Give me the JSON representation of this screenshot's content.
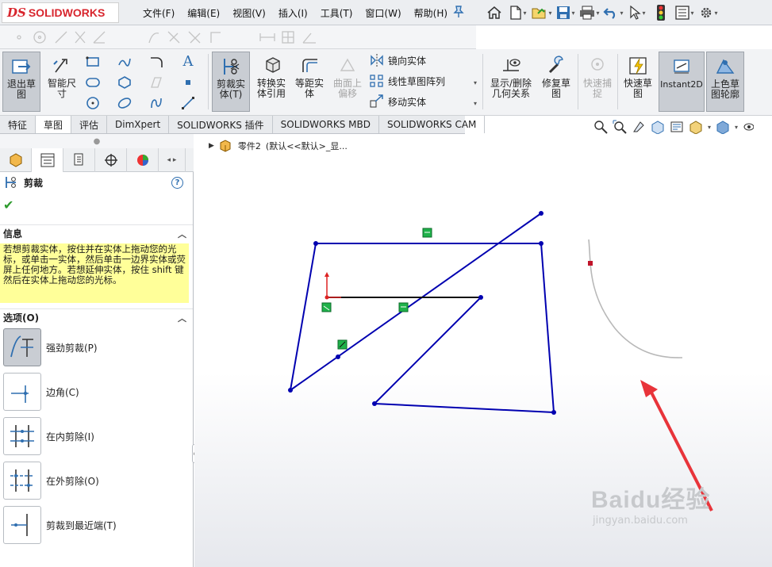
{
  "app": {
    "logo_prefix": "DS",
    "logo_text": "SOLIDWORKS"
  },
  "menu": {
    "items": [
      "文件(F)",
      "编辑(E)",
      "视图(V)",
      "插入(I)",
      "工具(T)",
      "窗口(W)",
      "帮助(H)"
    ]
  },
  "quick_access": [
    "home-icon",
    "new-document-icon",
    "open-folder-icon",
    "save-icon",
    "print-icon",
    "undo-icon",
    "select-cursor-icon",
    "rebuild-traffic-light-icon",
    "file-properties-icon",
    "options-gear-icon"
  ],
  "commands": {
    "exit_sketch": "退出草图",
    "smart_dimension": "智能尺寸",
    "trim_entities": "剪裁实体(T)",
    "convert_entities": "转换实体引用",
    "offset_entities": "等距实体",
    "offset_on_surface": "曲面上偏移",
    "mirror_entities": "镜向实体",
    "linear_pattern": "线性草图阵列",
    "move_entities": "移动实体",
    "display_delete_relations": "显示/删除几何关系",
    "repair_sketch": "修复草图",
    "quick_snaps": "快速捕捉",
    "rapid_sketch": "快速草图",
    "instant2d": "Instant2D",
    "shaded_contours": "上色草图轮廓"
  },
  "tabs": [
    "特征",
    "草图",
    "评估",
    "DimXpert",
    "SOLIDWORKS 插件",
    "SOLIDWORKS MBD",
    "SOLIDWORKS CAM"
  ],
  "active_tab": "草图",
  "property_manager": {
    "title": "剪裁",
    "info_header": "信息",
    "info_text": "若想剪裁实体，按住并在实体上拖动您的光标，或单击一实体，然后单击一边界实体或荧屏上任何地方。若想延伸实体，按住 shift 键然后在实体上拖动您的光标。",
    "options_header": "选项(O)",
    "options": [
      {
        "label": "强劲剪裁(P)",
        "selected": true
      },
      {
        "label": "边角(C)",
        "selected": false
      },
      {
        "label": "在内剪除(I)",
        "selected": false
      },
      {
        "label": "在外剪除(O)",
        "selected": false
      },
      {
        "label": "剪裁到最近端(T)",
        "selected": false
      }
    ]
  },
  "feature_tree": {
    "part": "零件2",
    "config": "(默认<<默认>_显..."
  },
  "colors": {
    "sketch_line": "#0000b0",
    "trim_trail": "#b8b8b8",
    "arrow": "#e8343a",
    "relation_marker": "#1fb24a",
    "info_bg": "#ffff99"
  },
  "watermark": {
    "text": "Baidu经验",
    "sub": "jingyan.baidu.com"
  }
}
